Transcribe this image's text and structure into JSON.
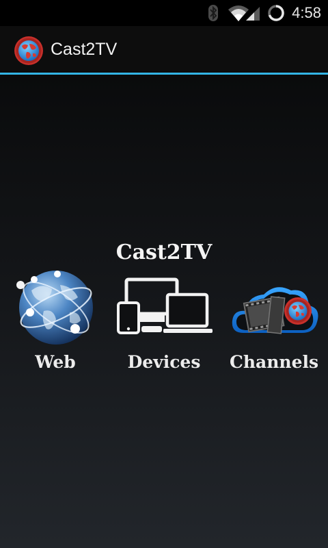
{
  "status_bar": {
    "time": "4:58",
    "icons": [
      "bluetooth-icon",
      "wifi-icon",
      "cell-signal-icon",
      "sync-progress-icon"
    ]
  },
  "action_bar": {
    "title": "Cast2TV",
    "logo_icon": "globe-logo-icon",
    "accent_color": "#33b5e5"
  },
  "main": {
    "heading": "Cast2TV",
    "tiles": [
      {
        "label": "Web",
        "icon": "globe-network-icon"
      },
      {
        "label": "Devices",
        "icon": "devices-icon"
      },
      {
        "label": "Channels",
        "icon": "cloud-film-icon"
      }
    ]
  }
}
